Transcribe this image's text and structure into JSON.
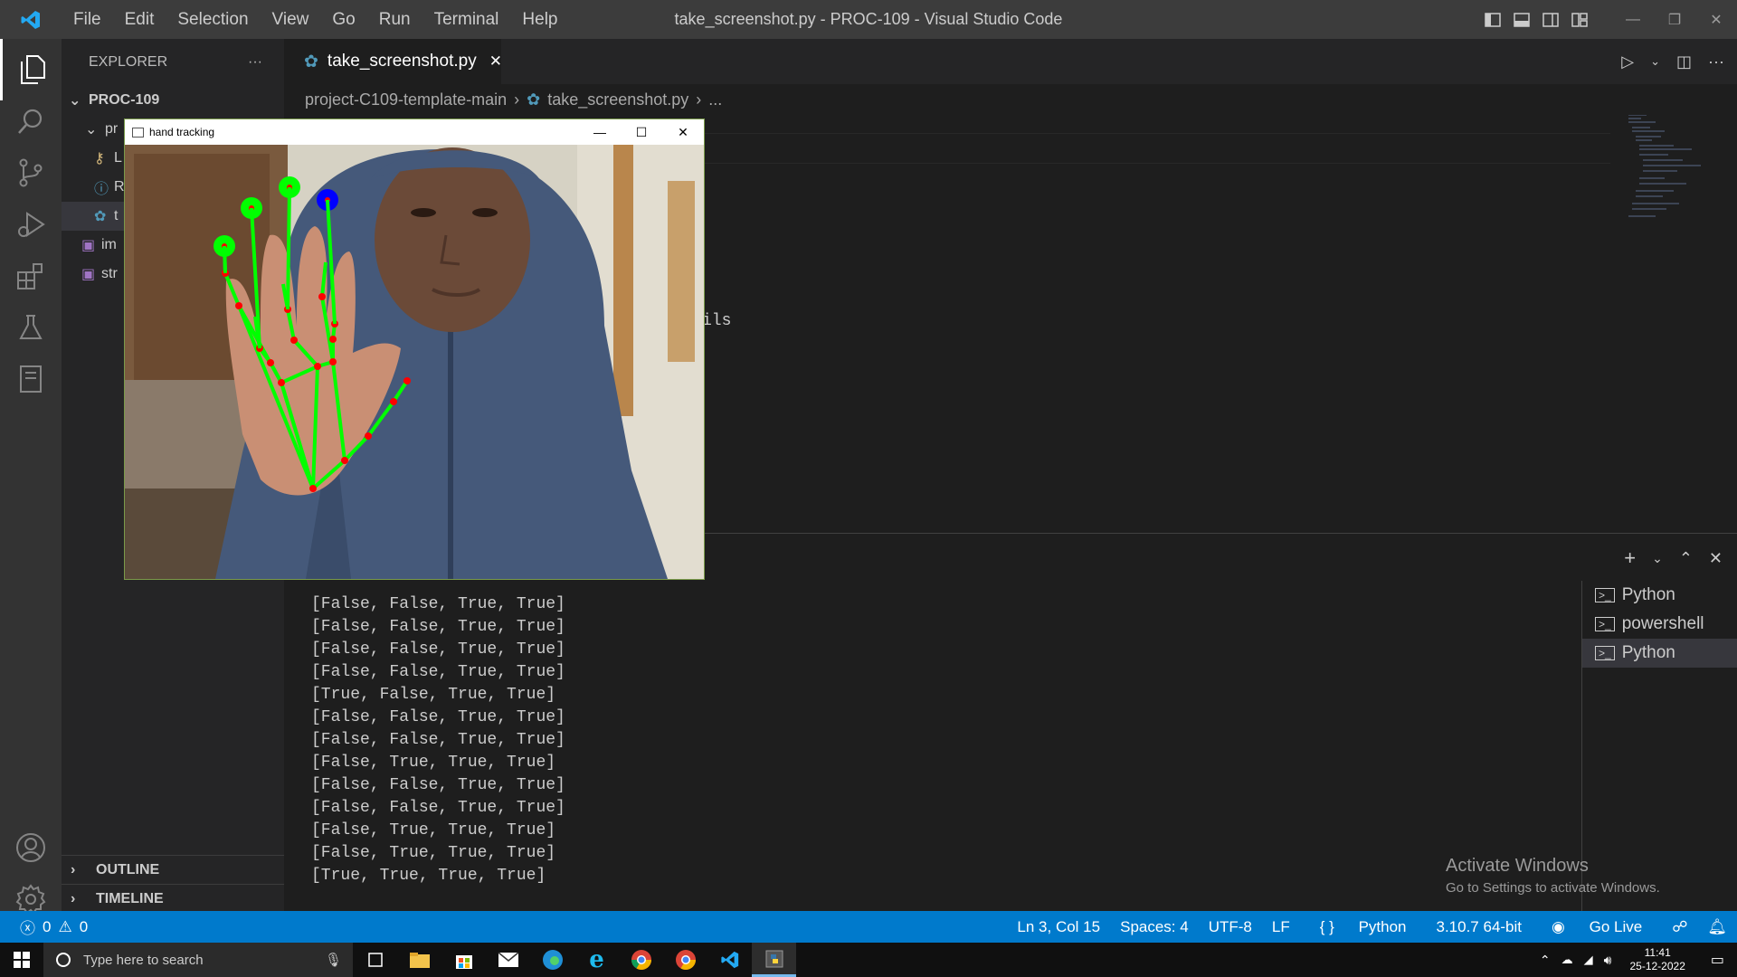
{
  "window": {
    "title": "take_screenshot.py - PROC-109 - Visual Studio Code"
  },
  "menu": [
    "File",
    "Edit",
    "Selection",
    "View",
    "Go",
    "Run",
    "Terminal",
    "Help"
  ],
  "sidebar": {
    "header": "EXPLORER",
    "header_more": "···",
    "project": "PROC-109",
    "items": [
      {
        "label": "pr",
        "icon": "chevron-down-icon"
      },
      {
        "label": "L",
        "icon": "key-icon"
      },
      {
        "label": "R",
        "icon": "info-icon"
      },
      {
        "label": "t",
        "icon": "python-file-icon"
      },
      {
        "label": "im",
        "icon": "image-file-icon"
      },
      {
        "label": "str",
        "icon": "image-file-icon"
      }
    ],
    "outline": "OUTLINE",
    "timeline": "TIMELINE"
  },
  "tab": {
    "label": "take_screenshot.py",
    "close": "✕"
  },
  "breadcrumb": {
    "folder": "project-C109-template-main",
    "file": "take_screenshot.py",
    "more": "..."
  },
  "editor": {
    "visible_fragment": "ils"
  },
  "terminal": {
    "lines": [
      "[False, False, True, True]",
      "[False, False, True, True]",
      "[False, False, True, True]",
      "[False, False, True, True]",
      "[True, False, True, True]",
      "[False, False, True, True]",
      "[False, False, True, True]",
      "[False, True, True, True]",
      "[False, False, True, True]",
      "[False, False, True, True]",
      "[False, True, True, True]",
      "[False, True, True, True]",
      "[True, True, True, True]"
    ],
    "sessions": [
      "Python",
      "powershell",
      "Python"
    ]
  },
  "watermark": {
    "line1": "Activate Windows",
    "line2": "Go to Settings to activate Windows."
  },
  "status": {
    "errors": "0",
    "warnings": "0",
    "position": "Ln 3, Col 15",
    "spaces": "Spaces: 4",
    "encoding": "UTF-8",
    "eol": "LF",
    "language": "Python",
    "interpreter": "3.10.7 64-bit",
    "golive": "Go Live"
  },
  "taskbar": {
    "search_placeholder": "Type here to search",
    "time": "11:41",
    "date": "25-12-2022"
  },
  "popup": {
    "title": "hand tracking",
    "minimize": "—",
    "maximize": "☐",
    "close": "✕"
  },
  "colors": {
    "accent": "#007acc",
    "landmark_line": "#00ff00",
    "landmark_point": "#ff0000",
    "fingertip": "#00ff00",
    "thumb_tip": "#0000ff"
  }
}
